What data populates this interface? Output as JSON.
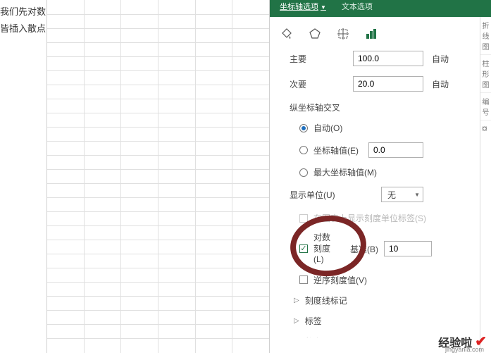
{
  "left_text_1": "我们先对数",
  "left_text_2": "皆插入散点",
  "panel": {
    "tabs": {
      "axis_options": "坐标轴选项",
      "text_options": "文本选项"
    },
    "rows": {
      "major": {
        "label": "主要",
        "value": "100.0",
        "auto": "自动"
      },
      "minor": {
        "label": "次要",
        "value": "20.0",
        "auto": "自动"
      }
    },
    "vert_cross": {
      "title": "纵坐标轴交叉",
      "auto": "自动(O)",
      "axis_value": "坐标轴值(E)",
      "axis_value_input": "0.0",
      "max_axis": "最大坐标轴值(M)"
    },
    "display_units": {
      "label": "显示单位(U)",
      "value": "无"
    },
    "show_unit_labels": "在图表上显示刻度单位标签(S)",
    "log_scale": {
      "label": "对数刻度(L)",
      "base_label": "基准(B)",
      "base_value": "10"
    },
    "reverse": "逆序刻度值(V)",
    "tree": {
      "tick_marks": "刻度线标记",
      "labels": "标签",
      "numbers": "数字"
    }
  },
  "right_stripe": [
    "折线图",
    "柱形图",
    "编号"
  ],
  "watermark": {
    "main": "经验啦",
    "sub": "jingyanla.com"
  }
}
